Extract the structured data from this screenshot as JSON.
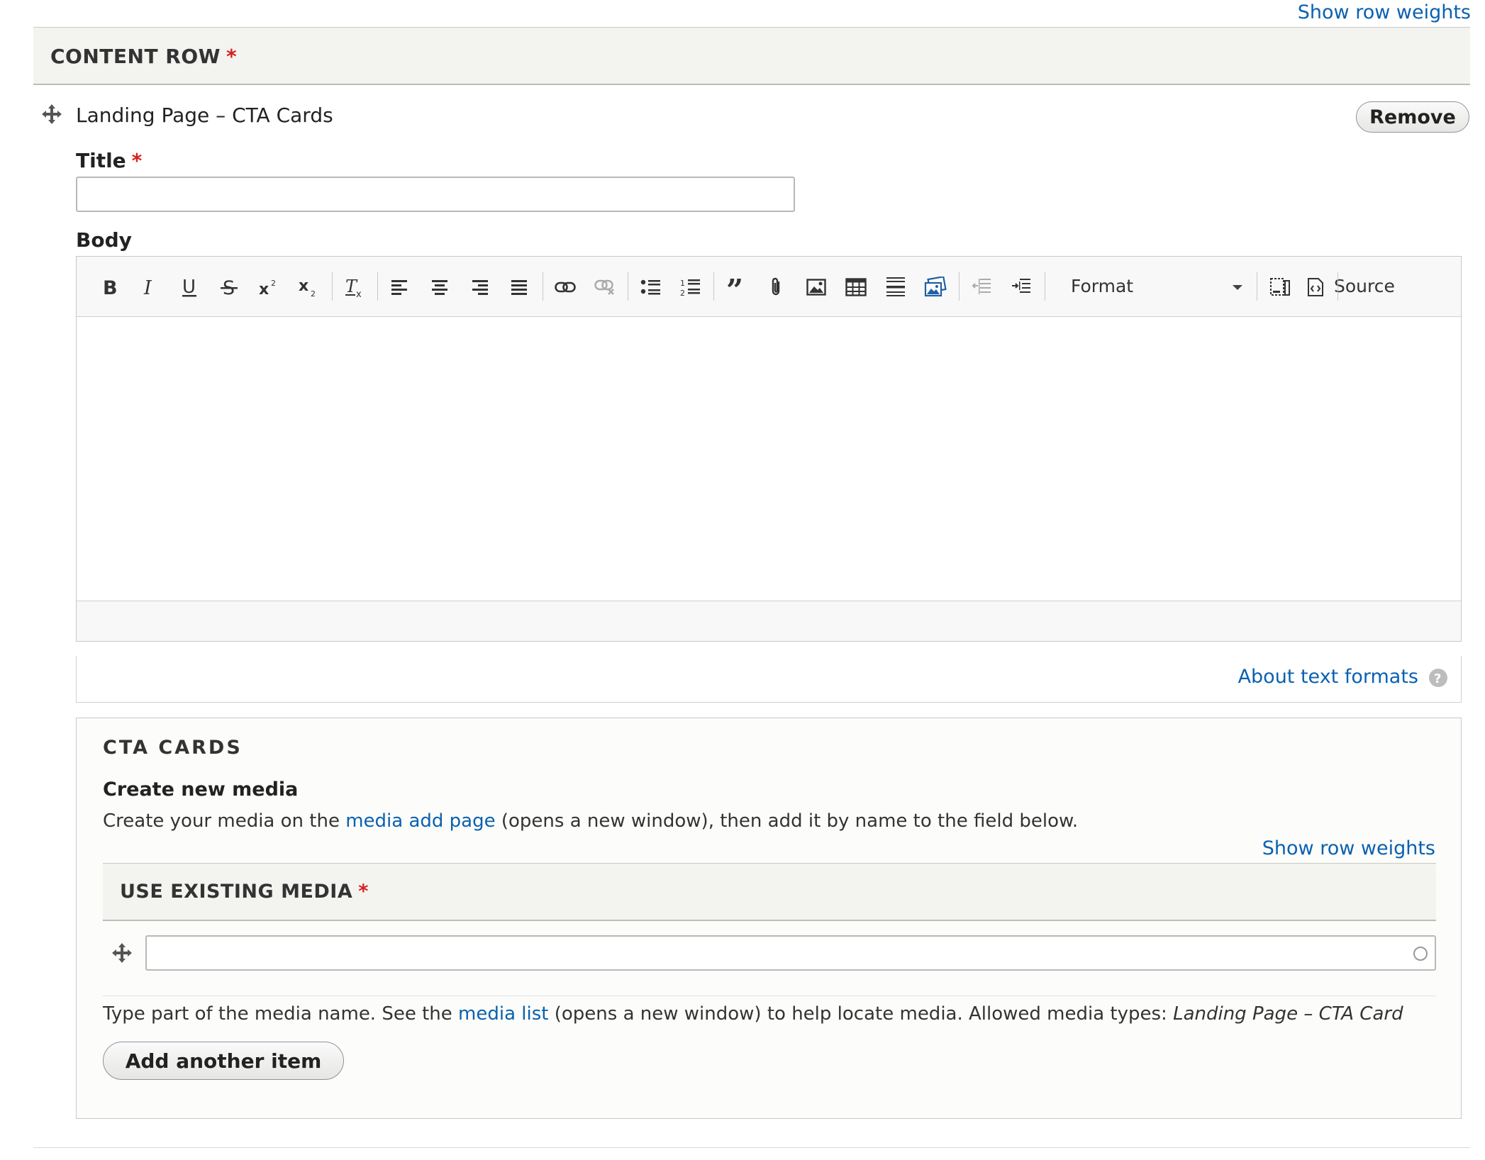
{
  "links": {
    "show_row_weights": "Show row weights"
  },
  "content_row": {
    "header": "CONTENT ROW",
    "required_mark": "*",
    "item_label": "Landing Page – CTA Cards",
    "remove_label": "Remove"
  },
  "fields": {
    "title_label": "Title",
    "title_required": "*",
    "title_value": "",
    "body_label": "Body"
  },
  "editor": {
    "toolbar_icons": [
      "bold-icon",
      "italic-icon",
      "underline-icon",
      "strikethrough-icon",
      "superscript-icon",
      "subscript-icon",
      "remove-format-icon",
      "align-left-icon",
      "align-center-icon",
      "align-right-icon",
      "align-justify-icon",
      "link-icon",
      "unlink-icon",
      "bulleted-list-icon",
      "numbered-list-icon",
      "blockquote-icon",
      "attachment-icon",
      "image-icon",
      "table-icon",
      "horizontal-rule-icon",
      "media-embed-icon",
      "outdent-icon",
      "indent-icon",
      "show-blocks-icon",
      "source-icon"
    ],
    "format_label": "Format",
    "source_label": "Source",
    "content": ""
  },
  "text_formats": {
    "about_label": "About text formats",
    "help_icon": "?"
  },
  "cta_cards": {
    "legend": "CTA CARDS",
    "create_label": "Create new media",
    "create_desc_prefix": "Create your media on the ",
    "create_desc_link": "media add page",
    "create_desc_suffix": " (opens a new window), then add it by name to the field below.",
    "media_header": "USE EXISTING MEDIA",
    "media_required": "*",
    "media_value": "",
    "media_desc_prefix": "Type part of the media name. See the ",
    "media_desc_link": "media list",
    "media_desc_middle": " (opens a new window) to help locate media. Allowed media types: ",
    "media_desc_types": "Landing Page – CTA Card",
    "add_item_label": "Add another item"
  },
  "colors": {
    "link": "#0a61b0",
    "required": "#d61f1f",
    "header_bg": "#f3f3f0"
  }
}
